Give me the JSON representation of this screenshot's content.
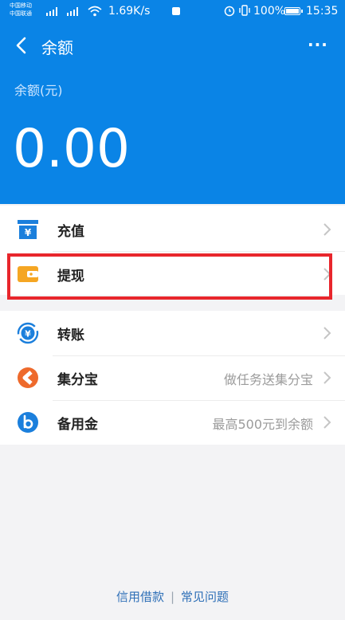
{
  "status_bar": {
    "carrier_1": "中国移动",
    "carrier_2": "中国联通",
    "net_speed": "1.69K/s",
    "battery_percent": "100%",
    "time": "15:35"
  },
  "header": {
    "title": "余额",
    "more_label": "···",
    "balance_label": "余额(元)",
    "balance_value": "0.00",
    "background_color": "#0a84e6"
  },
  "menu": {
    "group1": [
      {
        "label": "充值",
        "icon": "top-up-card-icon"
      },
      {
        "label": "提现",
        "icon": "wallet-icon"
      }
    ],
    "group2": [
      {
        "label": "转账",
        "icon": "transfer-yuan-icon"
      },
      {
        "label": "集分宝",
        "hint": "做任务送集分宝",
        "icon": "jifenbao-icon"
      },
      {
        "label": "备用金",
        "hint": "最高500元到余额",
        "icon": "beiyongjin-b-icon"
      }
    ]
  },
  "footer": {
    "link_1": "信用借款",
    "separator": "|",
    "link_2": "常见问题"
  },
  "highlight_color": "#e8262c"
}
